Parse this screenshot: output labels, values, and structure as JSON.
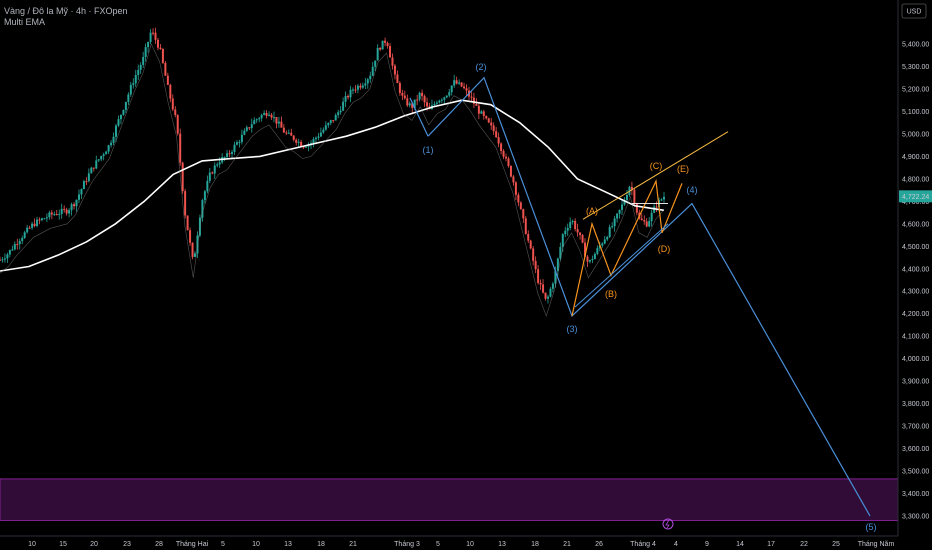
{
  "header": {
    "symbol_line": "Vàng / Đô la Mỹ · 4h · FXOpen",
    "indicator": "Multi EMA"
  },
  "price_axis": {
    "currency": "USD",
    "ticks": [
      "5,400.00",
      "5,300.00",
      "5,200.00",
      "5,100.00",
      "5,000.00",
      "4,900.00",
      "4,800.00",
      "4,700.00",
      "4,600.00",
      "4,500.00",
      "4,400.00",
      "4,300.00",
      "4,200.00",
      "4,100.00",
      "4,000.00",
      "3,900.00",
      "3,800.00",
      "3,700.00",
      "3,600.00",
      "3,500.00",
      "3,400.00",
      "3,300.00"
    ],
    "current_price": "4,722.24"
  },
  "time_axis": {
    "ticks": [
      "10",
      "15",
      "20",
      "23",
      "28",
      "Tháng Hai",
      "5",
      "10",
      "13",
      "18",
      "21",
      "Tháng 3",
      "5",
      "10",
      "13",
      "18",
      "21",
      "26",
      "Tháng 4",
      "4",
      "9",
      "14",
      "17",
      "22",
      "25",
      "Tháng Năm"
    ]
  },
  "wave_labels": {
    "w1": "(1)",
    "w2": "(2)",
    "w3": "(3)",
    "w4": "(4)",
    "w5": "(5)",
    "a": "(A)",
    "b": "(B)",
    "c": "(C)",
    "d": "(D)",
    "e": "(E)"
  },
  "colors": {
    "background": "#000000",
    "up_candle": "#26a69a",
    "down_candle": "#ef5350",
    "ema_long": "#ffffff",
    "wave_blue": "#4a90d9",
    "wave_orange": "#f7931e",
    "zone": "#6a1b7a",
    "price_badge": "#26a69a"
  },
  "chart_data": {
    "type": "candlestick",
    "title": "Vàng / Đô la Mỹ · 4h · FXOpen",
    "ylabel": "USD",
    "ylim": [
      3260,
      5480
    ],
    "grid": false,
    "current_price": 4722.24,
    "support_zone": [
      3280,
      3465
    ],
    "price_path": [
      [
        0,
        4440
      ],
      [
        1,
        4470
      ],
      [
        2,
        4520
      ],
      [
        3,
        4560
      ],
      [
        4,
        4600
      ],
      [
        5,
        4620
      ],
      [
        6,
        4640
      ],
      [
        7,
        4650
      ],
      [
        8,
        4660
      ],
      [
        9,
        4700
      ],
      [
        10,
        4780
      ],
      [
        11,
        4850
      ],
      [
        12,
        4900
      ],
      [
        13,
        4950
      ],
      [
        14,
        5050
      ],
      [
        15,
        5150
      ],
      [
        16,
        5250
      ],
      [
        17,
        5330
      ],
      [
        18,
        5460
      ],
      [
        19,
        5380
      ],
      [
        20,
        5200
      ],
      [
        21,
        5050
      ],
      [
        22,
        4650
      ],
      [
        23,
        4420
      ],
      [
        24,
        4700
      ],
      [
        25,
        4820
      ],
      [
        26,
        4880
      ],
      [
        27,
        4900
      ],
      [
        28,
        4950
      ],
      [
        29,
        5000
      ],
      [
        30,
        5050
      ],
      [
        31,
        5080
      ],
      [
        32,
        5100
      ],
      [
        33,
        5050
      ],
      [
        34,
        5000
      ],
      [
        35,
        4980
      ],
      [
        36,
        4950
      ],
      [
        37,
        4960
      ],
      [
        38,
        5000
      ],
      [
        39,
        5040
      ],
      [
        40,
        5080
      ],
      [
        41,
        5150
      ],
      [
        42,
        5200
      ],
      [
        43,
        5220
      ],
      [
        44,
        5260
      ],
      [
        45,
        5380
      ],
      [
        46,
        5420
      ],
      [
        47,
        5250
      ],
      [
        48,
        5150
      ],
      [
        49,
        5120
      ],
      [
        50,
        5180
      ],
      [
        51,
        5100
      ],
      [
        52,
        5150
      ],
      [
        53,
        5170
      ],
      [
        54,
        5230
      ],
      [
        55,
        5210
      ],
      [
        56,
        5160
      ],
      [
        57,
        5100
      ],
      [
        58,
        5050
      ],
      [
        59,
        5000
      ],
      [
        60,
        4900
      ],
      [
        61,
        4800
      ],
      [
        62,
        4650
      ],
      [
        63,
        4500
      ],
      [
        64,
        4350
      ],
      [
        65,
        4250
      ],
      [
        66,
        4370
      ],
      [
        67,
        4560
      ],
      [
        68,
        4620
      ],
      [
        69,
        4540
      ],
      [
        70,
        4420
      ],
      [
        71,
        4480
      ],
      [
        72,
        4540
      ],
      [
        73,
        4600
      ],
      [
        74,
        4680
      ],
      [
        75,
        4780
      ],
      [
        76,
        4620
      ],
      [
        77,
        4600
      ],
      [
        78,
        4680
      ],
      [
        79,
        4722
      ]
    ],
    "ema_long": [
      4390,
      4410,
      4460,
      4520,
      4600,
      4700,
      4820,
      4880,
      4890,
      4900,
      4930,
      4960,
      4990,
      5030,
      5080,
      5120,
      5150,
      5130,
      5050,
      4940,
      4800,
      4740,
      4680,
      4660
    ],
    "elliott_wave_main": [
      {
        "label": "(1)",
        "price": 4990
      },
      {
        "label": "(2)",
        "price": 5250
      },
      {
        "label": "(3)",
        "price": 4190
      },
      {
        "label": "(4)",
        "price": 4690
      },
      {
        "label": "(5)",
        "price": 3300
      }
    ],
    "abcde_triangle": [
      {
        "label": "(A)",
        "price": 4600
      },
      {
        "label": "(B)",
        "price": 4370
      },
      {
        "label": "(C)",
        "price": 4790
      },
      {
        "label": "(D)",
        "price": 4560
      },
      {
        "label": "(E)",
        "price": 4780
      }
    ]
  }
}
